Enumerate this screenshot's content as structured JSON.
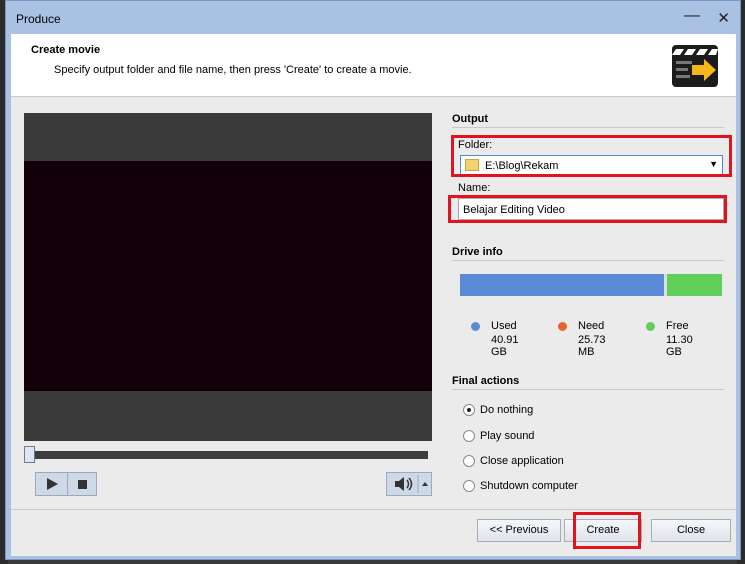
{
  "window": {
    "title": "Produce"
  },
  "header": {
    "title": "Create movie",
    "subtitle": "Specify output folder and file name, then press 'Create' to create a movie."
  },
  "output": {
    "section_label": "Output",
    "folder_label": "Folder:",
    "folder_value": "E:\\Blog\\Rekam",
    "name_label": "Name:",
    "name_value": "Belajar Editing Video"
  },
  "drive_info": {
    "section_label": "Drive info",
    "used_fraction": 0.78,
    "free_fraction": 0.21,
    "legend": [
      {
        "label": "Used",
        "value": "40.91 GB",
        "color": "#5b8bd6"
      },
      {
        "label": "Need",
        "value": "25.73 MB",
        "color": "#e8642a"
      },
      {
        "label": "Free",
        "value": "11.30 GB",
        "color": "#5fcf5a"
      }
    ]
  },
  "final_actions": {
    "section_label": "Final actions",
    "options": [
      {
        "label": "Do nothing",
        "selected": true
      },
      {
        "label": "Play sound",
        "selected": false
      },
      {
        "label": "Close application",
        "selected": false
      },
      {
        "label": "Shutdown computer",
        "selected": false
      }
    ]
  },
  "buttons": {
    "previous": "<< Previous",
    "create": "Create",
    "close": "Close"
  },
  "colors": {
    "highlight": "#e0141e",
    "accent": "#a9c1e2"
  }
}
